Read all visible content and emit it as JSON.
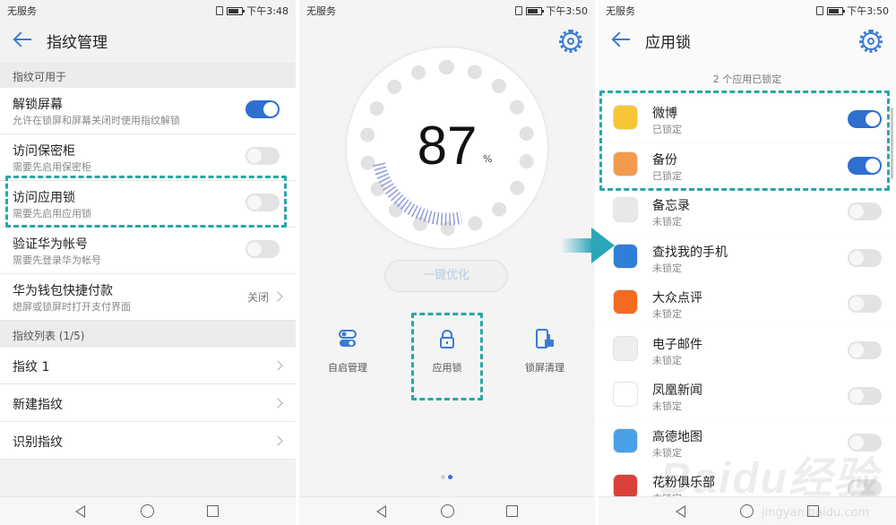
{
  "colors": {
    "accent": "#2f6fd0",
    "highlight_dash": "#2aa6a6",
    "arrow": "#2aa6b8"
  },
  "panel1": {
    "status": {
      "carrier": "无服务",
      "time": "下午3:48"
    },
    "title": "指纹管理",
    "section_available": "指纹可用于",
    "items": [
      {
        "title": "解锁屏幕",
        "subtitle": "允许在锁屏和屏幕关闭时使用指纹解锁",
        "toggle": "on"
      },
      {
        "title": "访问保密柜",
        "subtitle": "需要先启用保密柜",
        "toggle": "off"
      },
      {
        "title": "访问应用锁",
        "subtitle": "需要先启用应用锁",
        "toggle": "off"
      },
      {
        "title": "验证华为帐号",
        "subtitle": "需要先登录华为帐号",
        "toggle": "off"
      },
      {
        "title": "华为钱包快捷付款",
        "subtitle": "熄屏或锁屏时打开支付界面",
        "value": "关闭"
      }
    ],
    "section_list": "指纹列表 (1/5)",
    "fingerprints": [
      "指纹 1",
      "新建指纹",
      "识别指纹"
    ]
  },
  "panel2": {
    "status": {
      "carrier": "无服务",
      "time": "下午3:50"
    },
    "score": "87",
    "score_unit": "%",
    "optimize_label": "一键优化",
    "tools": [
      {
        "label": "自启管理",
        "icon": "toggle-switches-icon"
      },
      {
        "label": "应用锁",
        "icon": "padlock-icon"
      },
      {
        "label": "锁屏清理",
        "icon": "phone-brush-icon"
      }
    ]
  },
  "panel3": {
    "status": {
      "carrier": "无服务",
      "time": "下午3:50"
    },
    "title": "应用锁",
    "locked_count": "2 个应用已锁定",
    "apps": [
      {
        "name": "微博",
        "status": "已锁定",
        "toggle": "on",
        "icon": "weibo-icon",
        "color": "#f7c634"
      },
      {
        "name": "备份",
        "status": "已锁定",
        "toggle": "on",
        "icon": "backup-icon",
        "color": "#f29a4d"
      },
      {
        "name": "备忘录",
        "status": "未锁定",
        "toggle": "off",
        "icon": "notes-icon",
        "color": "#e8e8e8"
      },
      {
        "name": "查找我的手机",
        "status": "未锁定",
        "toggle": "off",
        "icon": "find-phone-icon",
        "color": "#2f7fd8"
      },
      {
        "name": "大众点评",
        "status": "未锁定",
        "toggle": "off",
        "icon": "dianping-icon",
        "color": "#f26b21"
      },
      {
        "name": "电子邮件",
        "status": "未锁定",
        "toggle": "off",
        "icon": "email-icon",
        "color": "#eeeeee"
      },
      {
        "name": "凤凰新闻",
        "status": "未锁定",
        "toggle": "off",
        "icon": "ifeng-icon",
        "color": "#ffffff"
      },
      {
        "name": "高德地图",
        "status": "未锁定",
        "toggle": "off",
        "icon": "amap-icon",
        "color": "#4aa0e6"
      },
      {
        "name": "花粉俱乐部",
        "status": "未锁定",
        "toggle": "off",
        "icon": "huafen-icon",
        "color": "#d9413a"
      }
    ]
  },
  "watermark": {
    "brand": "Baidu经验",
    "url": "jingyan.baidu.com"
  }
}
